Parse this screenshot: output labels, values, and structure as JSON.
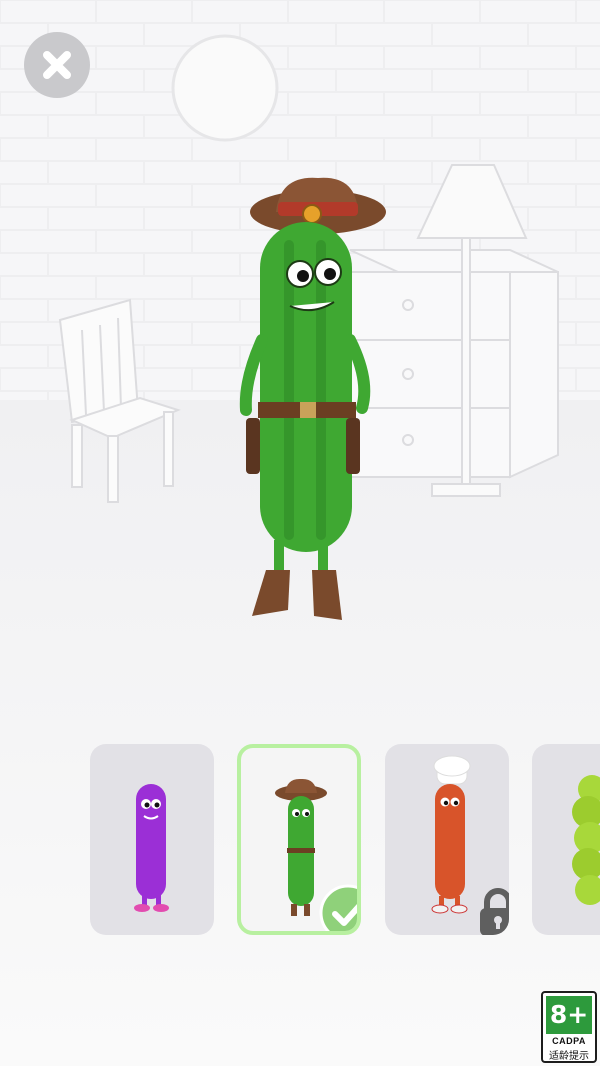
{
  "rating_badge": {
    "age": "8+",
    "org": "CADPA",
    "hint": "适龄提示"
  },
  "selected_skin_index": 1,
  "skins": [
    {
      "name": "purple-pickle",
      "status": "unlocked"
    },
    {
      "name": "cowboy-pickle",
      "status": "selected"
    },
    {
      "name": "chef-sausage",
      "status": "locked"
    },
    {
      "name": "green-caterpillar",
      "status": "unlocked"
    }
  ],
  "colors": {
    "pickle_green": "#3fa832",
    "purple_skin": "#9b2fd6",
    "sausage_orange": "#d8542a",
    "selected_border": "#b8f0a0",
    "check_green": "#8fd17a"
  }
}
